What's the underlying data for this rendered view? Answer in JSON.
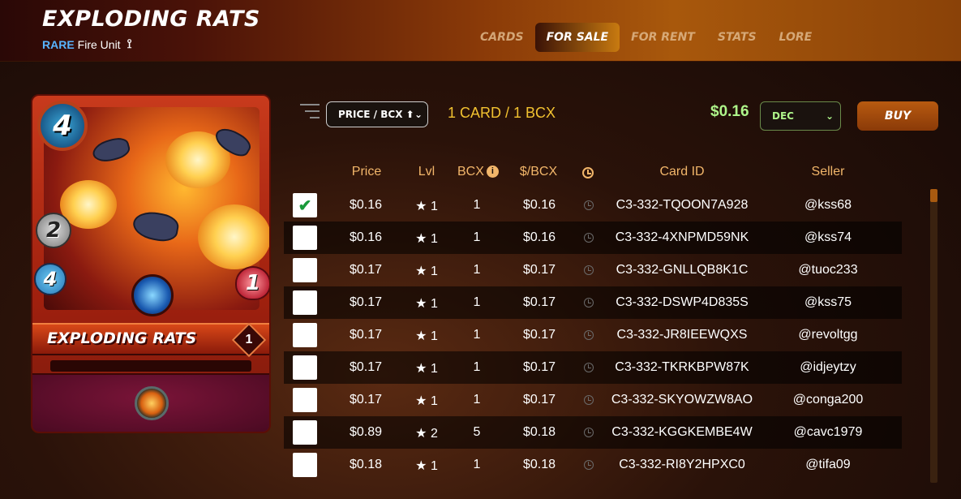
{
  "header": {
    "title": "EXPLODING RATS",
    "rarity": "RARE",
    "unit_type": "Fire Unit",
    "edition_icon": "reward-edition-icon"
  },
  "nav": {
    "tabs": [
      {
        "label": "CARDS",
        "active": false
      },
      {
        "label": "FOR SALE",
        "active": true
      },
      {
        "label": "FOR RENT",
        "active": false
      },
      {
        "label": "STATS",
        "active": false
      },
      {
        "label": "LORE",
        "active": false
      }
    ]
  },
  "card": {
    "name": "EXPLODING RATS",
    "mana": "4",
    "attack": "2",
    "speed": "4",
    "health": "1",
    "level": "1",
    "element": "water-element-icon",
    "ability_icon": "explode-ability-icon"
  },
  "toolbar": {
    "sort_icon": "sort-lines-icon",
    "sort_value": "PRICE / BCX ⬆",
    "summary": "1 CARD / 1 BCX",
    "total_price": "$0.16",
    "currency_value": "DEC",
    "buy_label": "BUY"
  },
  "table": {
    "headers": {
      "price": "Price",
      "lvl": "Lvl",
      "bcx": "BCX",
      "per_bcx": "$/BCX",
      "card_id": "Card ID",
      "seller": "Seller"
    },
    "rows": [
      {
        "checked": true,
        "price": "$0.16",
        "lvl": "★ 1",
        "bcx": "1",
        "per_bcx": "$0.16",
        "card_id": "C3-332-TQOON7A928",
        "seller": "@kss68"
      },
      {
        "checked": false,
        "price": "$0.16",
        "lvl": "★ 1",
        "bcx": "1",
        "per_bcx": "$0.16",
        "card_id": "C3-332-4XNPMD59NK",
        "seller": "@kss74"
      },
      {
        "checked": false,
        "price": "$0.17",
        "lvl": "★ 1",
        "bcx": "1",
        "per_bcx": "$0.17",
        "card_id": "C3-332-GNLLQB8K1C",
        "seller": "@tuoc233"
      },
      {
        "checked": false,
        "price": "$0.17",
        "lvl": "★ 1",
        "bcx": "1",
        "per_bcx": "$0.17",
        "card_id": "C3-332-DSWP4D835S",
        "seller": "@kss75"
      },
      {
        "checked": false,
        "price": "$0.17",
        "lvl": "★ 1",
        "bcx": "1",
        "per_bcx": "$0.17",
        "card_id": "C3-332-JR8IEEWQXS",
        "seller": "@revoltgg"
      },
      {
        "checked": false,
        "price": "$0.17",
        "lvl": "★ 1",
        "bcx": "1",
        "per_bcx": "$0.17",
        "card_id": "C3-332-TKRKBPW87K",
        "seller": "@idjeytzy"
      },
      {
        "checked": false,
        "price": "$0.17",
        "lvl": "★ 1",
        "bcx": "1",
        "per_bcx": "$0.17",
        "card_id": "C3-332-SKYOWZW8AO",
        "seller": "@conga200"
      },
      {
        "checked": false,
        "price": "$0.89",
        "lvl": "★ 2",
        "bcx": "5",
        "per_bcx": "$0.18",
        "card_id": "C3-332-KGGKEMBE4W",
        "seller": "@cavc1979"
      },
      {
        "checked": false,
        "price": "$0.18",
        "lvl": "★ 1",
        "bcx": "1",
        "per_bcx": "$0.18",
        "card_id": "C3-332-RI8Y2HPXC0",
        "seller": "@tifa09"
      }
    ]
  }
}
